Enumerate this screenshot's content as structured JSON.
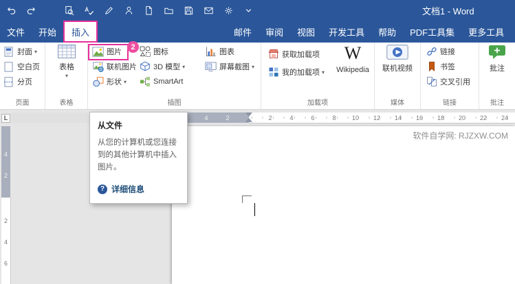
{
  "window": {
    "title": "文档1 - Word"
  },
  "qat": {
    "icons": [
      "undo-icon",
      "redo-icon",
      "print-preview-icon",
      "spelling-icon",
      "draw-icon",
      "contact-icon",
      "new-document-icon",
      "open-icon",
      "save-icon",
      "email-icon",
      "touch-mode-icon",
      "qat-more-icon"
    ]
  },
  "tabs": {
    "items": [
      {
        "label": "文件"
      },
      {
        "label": "开始"
      },
      {
        "label": "插入",
        "active": true
      },
      {
        "label": "邮件"
      },
      {
        "label": "审阅"
      },
      {
        "label": "视图"
      },
      {
        "label": "开发工具"
      },
      {
        "label": "帮助"
      },
      {
        "label": "PDF工具集"
      },
      {
        "label": "更多工具"
      }
    ]
  },
  "ribbon": {
    "groups": {
      "page": {
        "label": "页面",
        "items": {
          "cover": {
            "label": "封面",
            "dropdown": "▾"
          },
          "blank": {
            "label": "空白页"
          },
          "break": {
            "label": "分页"
          }
        }
      },
      "table": {
        "label": "表格",
        "button": {
          "label": "表格",
          "dropdown": "▾"
        }
      },
      "illustrations": {
        "label": "插图",
        "items": {
          "picture": {
            "label": "图片"
          },
          "online_pictures": {
            "label": "联机图片"
          },
          "shapes": {
            "label": "形状",
            "dropdown": "▾"
          },
          "icons": {
            "label": "图标"
          },
          "models": {
            "label": "3D 模型",
            "dropdown": "▾"
          },
          "smartart": {
            "label": "SmartArt"
          },
          "chart": {
            "label": "图表"
          },
          "screenshot": {
            "label": "屏幕截图",
            "dropdown": "▾"
          }
        }
      },
      "addins": {
        "label": "加载项",
        "items": {
          "get": {
            "label": "获取加载项"
          },
          "my": {
            "label": "我的加载项",
            "dropdown": "▾"
          },
          "wikipedia": {
            "label": "Wikipedia",
            "glyph": "W"
          }
        }
      },
      "media": {
        "label": "媒体",
        "items": {
          "video": {
            "label": "联机视频"
          }
        }
      },
      "links": {
        "label": "链接",
        "items": {
          "link": {
            "label": "链接"
          },
          "bookmark": {
            "label": "书签"
          },
          "crossref": {
            "label": "交叉引用"
          }
        }
      },
      "comments": {
        "label": "批注",
        "items": {
          "comment": {
            "label": "批注"
          }
        }
      }
    }
  },
  "annotation": {
    "badge": "2",
    "color": "#e6309b"
  },
  "tooltip": {
    "title": "从文件",
    "body": "从您的计算机或您连接到的其他计算机中插入图片。",
    "help_glyph": "?",
    "link": "详细信息"
  },
  "ruler": {
    "tab_selector": "L",
    "h_margin_numbers": [
      "4",
      "2"
    ],
    "h_numbers": [
      "2",
      "4",
      "6",
      "8",
      "10",
      "12",
      "14",
      "16",
      "18",
      "20",
      "22",
      "24"
    ],
    "v_margin_numbers": [
      "4",
      "2"
    ],
    "v_numbers": [
      "2",
      "4",
      "6"
    ]
  },
  "document": {
    "watermark": "软件自学网: RJZXW.COM"
  }
}
